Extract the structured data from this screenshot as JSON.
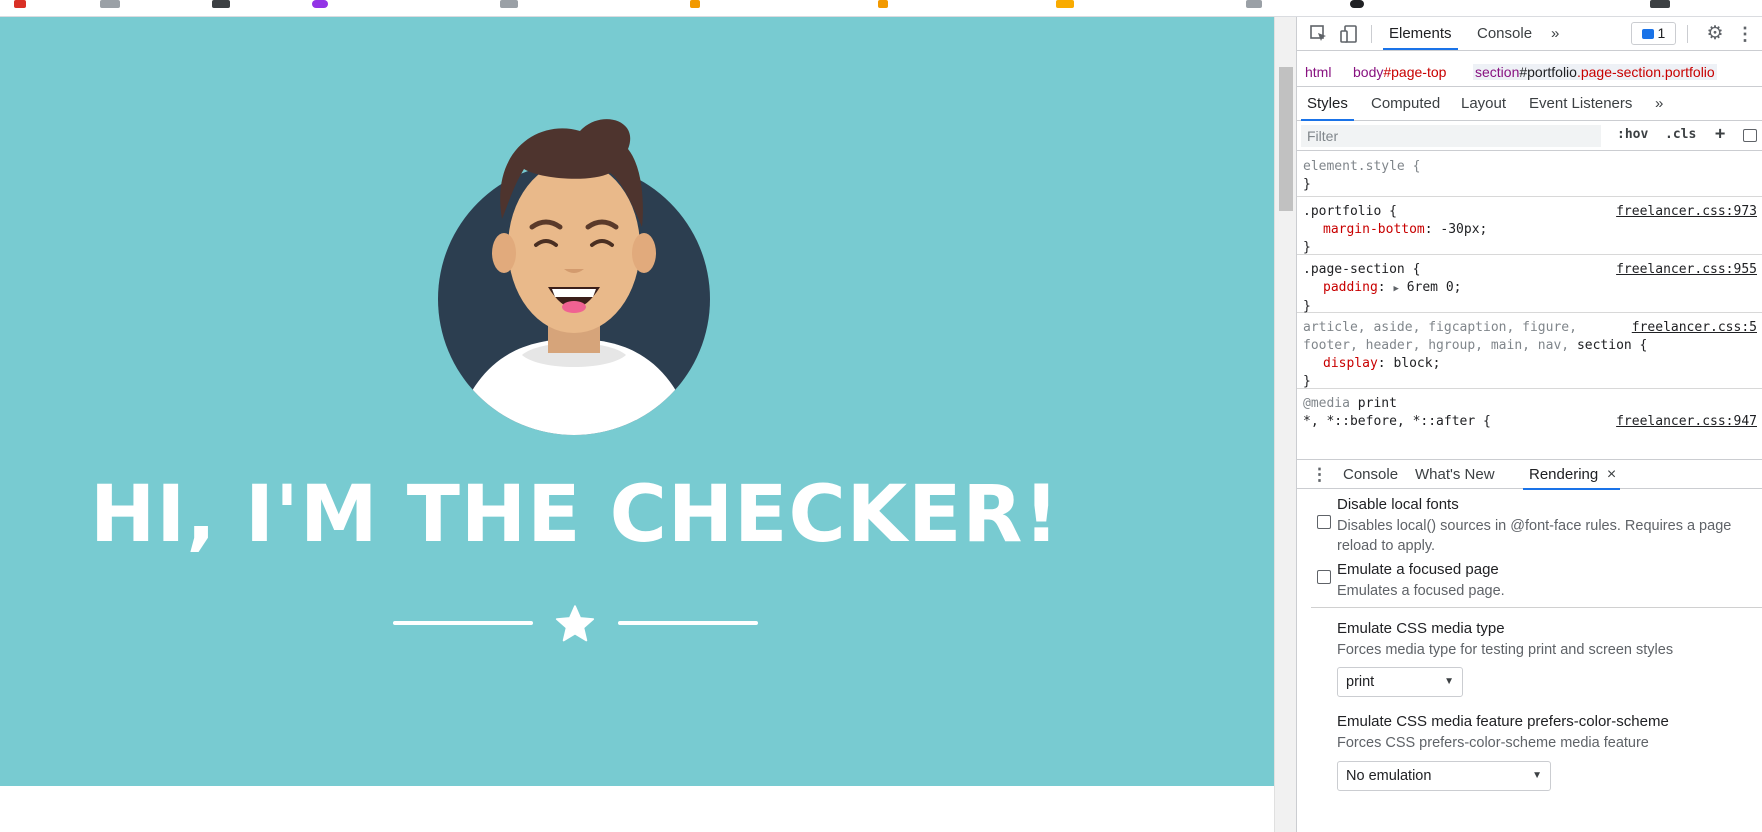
{
  "bookmarks": {
    "colors": [
      "#d93025",
      "#3c4043",
      "#3c4043",
      "#9334e6",
      "#3c4043",
      "#f29900",
      "#f29900",
      "#f9ab00",
      "#5f6368",
      "#202124"
    ]
  },
  "page": {
    "hero_title": "HI, I'M THE CHECKER!",
    "background": "#78cbd1",
    "avatar_icon": "smiling-man-avatar",
    "divider_icon": "star-icon"
  },
  "devtools": {
    "toolbar": {
      "tabs": [
        "Elements",
        "Console"
      ],
      "more_tabs": "»",
      "issues_count": "1",
      "icons": [
        "inspect-element-icon",
        "device-toggle-icon",
        "settings-gear-icon",
        "kebab-menu-icon"
      ]
    },
    "breadcrumbs": {
      "html": "html",
      "body_tag": "body",
      "body_id": "#page-top",
      "section_tag": "section",
      "section_id": "#portfolio",
      "section_classes": ".page-section.portfolio"
    },
    "subtabs": [
      "Styles",
      "Computed",
      "Layout",
      "Event Listeners"
    ],
    "subtabs_more": "»",
    "filter": {
      "placeholder": "Filter",
      "hov": ":hov",
      "cls": ".cls",
      "add": "+"
    },
    "styles": {
      "element_style": "element.style {",
      "close": "}",
      "rule1": {
        "selector": ".portfolio {",
        "source": "freelancer.css:973",
        "prop": "margin-bottom",
        "value": "-30px;"
      },
      "rule2": {
        "selector": ".page-section {",
        "source": "freelancer.css:955",
        "prop": "padding",
        "value": "6rem 0;"
      },
      "rule3": {
        "selector_line1": "article, aside, figcaption, figure,",
        "selector_line2_dim": "footer, header, hgroup, main, nav, ",
        "selector_line2_match": "section {",
        "source": "freelancer.css:5",
        "prop": "display",
        "value": "block;"
      },
      "rule4": {
        "media": "@media",
        "media_type": "print",
        "selector": "*, *::before, *::after {",
        "source": "freelancer.css:947"
      }
    },
    "drawer": {
      "tabs": [
        "Console",
        "What's New",
        "Rendering"
      ],
      "close": "×"
    },
    "rendering": {
      "disable_fonts_title": "Disable local fonts",
      "disable_fonts_desc": "Disables local() sources in @font-face rules. Requires a page reload to apply.",
      "focused_title": "Emulate a focused page",
      "focused_desc": "Emulates a focused page.",
      "media_type_title": "Emulate CSS media type",
      "media_type_desc": "Forces media type for testing print and screen styles",
      "media_type_value": "print",
      "color_scheme_title": "Emulate CSS media feature prefers-color-scheme",
      "color_scheme_desc": "Forces CSS prefers-color-scheme media feature",
      "color_scheme_value": "No emulation"
    }
  }
}
